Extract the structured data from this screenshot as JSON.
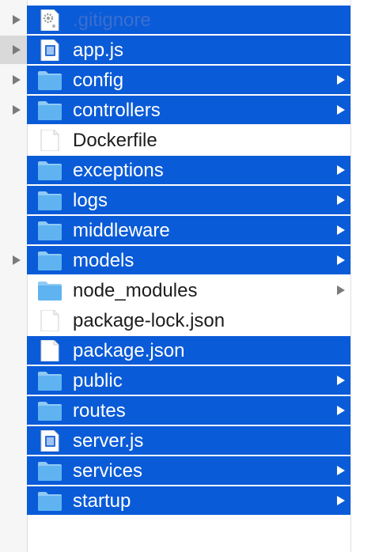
{
  "files": [
    {
      "name": ".gitignore",
      "kind": "gear-file",
      "selected": true,
      "dim": true,
      "folder": false,
      "gutter_arrow": true,
      "gutter_hover": false
    },
    {
      "name": "app.js",
      "kind": "js-file",
      "selected": true,
      "dim": false,
      "folder": false,
      "gutter_arrow": true,
      "gutter_hover": true
    },
    {
      "name": "config",
      "kind": "folder",
      "selected": true,
      "dim": false,
      "folder": true,
      "gutter_arrow": true,
      "gutter_hover": false
    },
    {
      "name": "controllers",
      "kind": "folder",
      "selected": true,
      "dim": false,
      "folder": true,
      "gutter_arrow": true,
      "gutter_hover": false
    },
    {
      "name": "Dockerfile",
      "kind": "doc-file",
      "selected": false,
      "dim": false,
      "folder": false,
      "gutter_arrow": false,
      "gutter_hover": false
    },
    {
      "name": "exceptions",
      "kind": "folder",
      "selected": true,
      "dim": false,
      "folder": true,
      "gutter_arrow": false,
      "gutter_hover": false
    },
    {
      "name": "logs",
      "kind": "folder",
      "selected": true,
      "dim": false,
      "folder": true,
      "gutter_arrow": false,
      "gutter_hover": false
    },
    {
      "name": "middleware",
      "kind": "folder",
      "selected": true,
      "dim": false,
      "folder": true,
      "gutter_arrow": false,
      "gutter_hover": false
    },
    {
      "name": "models",
      "kind": "folder",
      "selected": true,
      "dim": false,
      "folder": true,
      "gutter_arrow": true,
      "gutter_hover": false
    },
    {
      "name": "node_modules",
      "kind": "folder",
      "selected": false,
      "dim": false,
      "folder": true,
      "gutter_arrow": false,
      "gutter_hover": false
    },
    {
      "name": "package-lock.json",
      "kind": "doc-file",
      "selected": false,
      "dim": false,
      "folder": false,
      "gutter_arrow": false,
      "gutter_hover": false
    },
    {
      "name": "package.json",
      "kind": "doc-file",
      "selected": true,
      "dim": false,
      "folder": false,
      "gutter_arrow": false,
      "gutter_hover": false
    },
    {
      "name": "public",
      "kind": "folder",
      "selected": true,
      "dim": false,
      "folder": true,
      "gutter_arrow": false,
      "gutter_hover": false
    },
    {
      "name": "routes",
      "kind": "folder",
      "selected": true,
      "dim": false,
      "folder": true,
      "gutter_arrow": false,
      "gutter_hover": false
    },
    {
      "name": "server.js",
      "kind": "js-file",
      "selected": true,
      "dim": false,
      "folder": false,
      "gutter_arrow": false,
      "gutter_hover": false
    },
    {
      "name": "services",
      "kind": "folder",
      "selected": true,
      "dim": false,
      "folder": true,
      "gutter_arrow": false,
      "gutter_hover": false
    },
    {
      "name": "startup",
      "kind": "folder",
      "selected": true,
      "dim": false,
      "folder": true,
      "gutter_arrow": false,
      "gutter_hover": false
    }
  ],
  "colors": {
    "selection": "#0a5bd8",
    "folder_body": "#5fb3f0",
    "folder_tab": "#8fcaf5"
  }
}
